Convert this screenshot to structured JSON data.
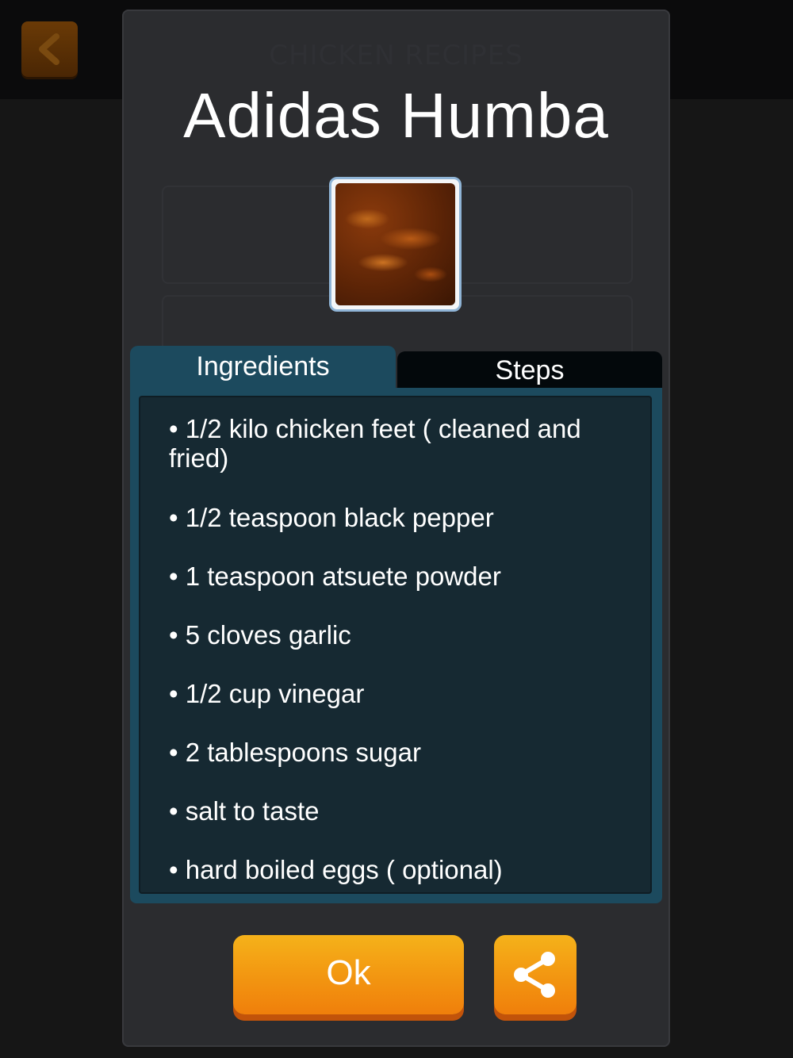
{
  "background": {
    "header_title": "CHICKEN RECIPES",
    "back_button_icon": "chevron-left-icon"
  },
  "recipe": {
    "title": "Adidas Humba",
    "photo_alt": "Adidas Humba"
  },
  "tabs": [
    {
      "label": "Ingredients",
      "active": true
    },
    {
      "label": "Steps",
      "active": false
    }
  ],
  "ingredients": [
    "• 1/2 kilo chicken feet ( cleaned and fried)",
    "• 1/2 teaspoon black pepper",
    "• 1 teaspoon atsuete powder",
    "• 5 cloves garlic",
    "• 1/2 cup vinegar",
    "• 2 tablespoons sugar",
    "• salt to taste",
    "• hard boiled eggs ( optional)"
  ],
  "buttons": {
    "ok_label": "Ok",
    "share_icon": "share-icon"
  },
  "colors": {
    "accent_orange": "#f39a12",
    "panel_teal": "#1c4a5e",
    "panel_inner": "#162932",
    "modal_bg": "#2b2c2f"
  }
}
